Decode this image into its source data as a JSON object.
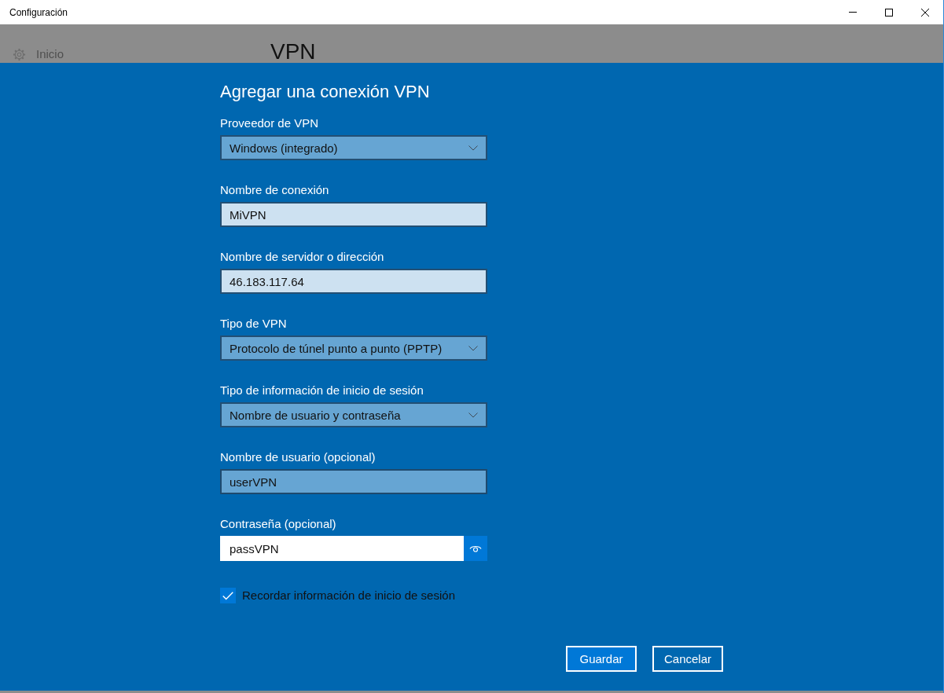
{
  "window": {
    "title": "Configuración"
  },
  "background": {
    "nav_item": "Inicio",
    "page_title": "VPN"
  },
  "dialog": {
    "title": "Agregar una conexión VPN",
    "fields": [
      {
        "kind": "dropdown",
        "label": "Proveedor de VPN",
        "value": "Windows (integrado)",
        "hovered": false,
        "focused": false
      },
      {
        "kind": "text",
        "label": "Nombre de conexión",
        "value": "MiVPN",
        "hovered": false,
        "focused": false
      },
      {
        "kind": "text",
        "label": "Nombre de servidor o dirección",
        "value": "46.183.117.64",
        "hovered": false,
        "focused": false
      },
      {
        "kind": "dropdown",
        "label": "Tipo de VPN",
        "value": "Protocolo de túnel punto a punto (PPTP)",
        "hovered": false,
        "focused": false
      },
      {
        "kind": "dropdown",
        "label": "Tipo de información de inicio de sesión",
        "value": "Nombre de usuario y contraseña",
        "hovered": false,
        "focused": false
      },
      {
        "kind": "text",
        "label": "Nombre de usuario (opcional)",
        "value": "userVPN",
        "hovered": true,
        "focused": false
      },
      {
        "kind": "password",
        "label": "Contraseña (opcional)",
        "value": "passVPN",
        "hovered": false,
        "focused": true
      }
    ],
    "remember": {
      "label": "Recordar información de inicio de sesión",
      "checked": true
    },
    "buttons": [
      {
        "label": "Guardar",
        "default": true
      },
      {
        "label": "Cancelar",
        "default": false
      }
    ]
  }
}
